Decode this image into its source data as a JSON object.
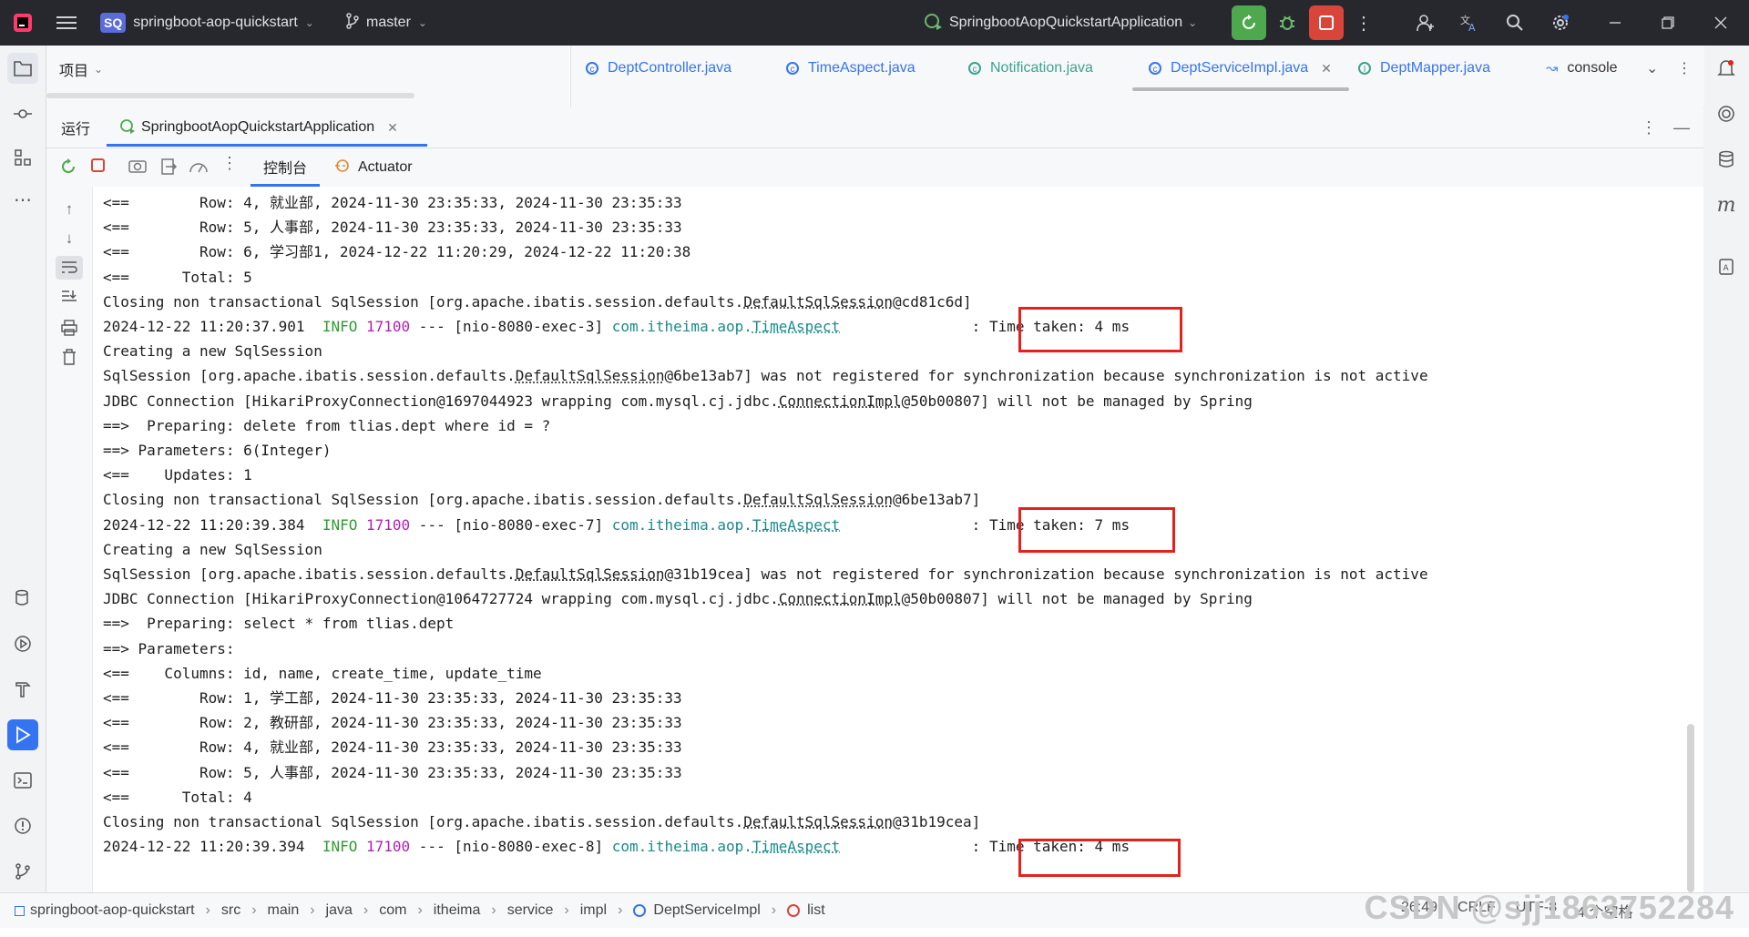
{
  "titlebar": {
    "project_badge": "SQ",
    "project_name": "springboot-aop-quickstart",
    "branch": "master",
    "run_config": "SpringbootAopQuickstartApplication"
  },
  "project_panel": {
    "title": "项目"
  },
  "editor_tabs": [
    {
      "label": "DeptController.java",
      "icon": "class-icon"
    },
    {
      "label": "TimeAspect.java",
      "icon": "class-icon"
    },
    {
      "label": "Notification.java",
      "icon": "class-icon"
    },
    {
      "label": "DeptServiceImpl.java",
      "icon": "class-icon",
      "active": true
    },
    {
      "label": "DeptMapper.java",
      "icon": "interface-icon"
    },
    {
      "label": "console",
      "icon": "console-icon"
    }
  ],
  "run_panel": {
    "title": "运行",
    "config_tab": "SpringbootAopQuickstartApplication",
    "tab_console": "控制台",
    "tab_actuator": "Actuator"
  },
  "console_lines": [
    {
      "parts": [
        {
          "t": "<==        Row: 4, 就业部, 2024-11-30 23:35:33, 2024-11-30 23:35:33"
        }
      ]
    },
    {
      "parts": [
        {
          "t": "<==        Row: 5, 人事部, 2024-11-30 23:35:33, 2024-11-30 23:35:33"
        }
      ]
    },
    {
      "parts": [
        {
          "t": "<==        Row: 6, 学习部1, 2024-12-22 11:20:29, 2024-12-22 11:20:38"
        }
      ]
    },
    {
      "parts": [
        {
          "t": "<==      Total: 5"
        }
      ]
    },
    {
      "parts": [
        {
          "t": "Closing non transactional SqlSession [org.apache.ibatis.session.defaults."
        },
        {
          "t": "DefaultSqlSession",
          "c": "ul"
        },
        {
          "t": "@cd81c6d]"
        }
      ]
    },
    {
      "parts": [
        {
          "t": "2024-12-22 11:20:37.901  "
        },
        {
          "t": "INFO",
          "c": "info"
        },
        {
          "t": " "
        },
        {
          "t": "17100",
          "c": "pid"
        },
        {
          "t": " --- [nio-8080-exec-3] "
        },
        {
          "t": "com.itheima.aop.",
          "c": "cls"
        },
        {
          "t": "TimeAspect",
          "c": "cls ul"
        },
        {
          "t": "               : Time taken: 4 ms"
        }
      ]
    },
    {
      "parts": [
        {
          "t": "Creating a new SqlSession"
        }
      ]
    },
    {
      "parts": [
        {
          "t": "SqlSession [org.apache.ibatis.session.defaults."
        },
        {
          "t": "DefaultSqlSession",
          "c": "ul"
        },
        {
          "t": "@6be13ab7] was not registered for synchronization because synchronization is not active"
        }
      ]
    },
    {
      "parts": [
        {
          "t": "JDBC Connection [HikariProxyConnection@1697044923 wrapping com.mysql.cj.jdbc."
        },
        {
          "t": "ConnectionImpl",
          "c": "ul"
        },
        {
          "t": "@50b00807] will not be managed by Spring"
        }
      ]
    },
    {
      "parts": [
        {
          "t": "==>  Preparing: delete from tlias.dept where id = ?"
        }
      ]
    },
    {
      "parts": [
        {
          "t": "==> Parameters: 6(Integer)"
        }
      ]
    },
    {
      "parts": [
        {
          "t": "<==    Updates: 1"
        }
      ]
    },
    {
      "parts": [
        {
          "t": "Closing non transactional SqlSession [org.apache.ibatis.session.defaults."
        },
        {
          "t": "DefaultSqlSession",
          "c": "ul"
        },
        {
          "t": "@6be13ab7]"
        }
      ]
    },
    {
      "parts": [
        {
          "t": "2024-12-22 11:20:39.384  "
        },
        {
          "t": "INFO",
          "c": "info"
        },
        {
          "t": " "
        },
        {
          "t": "17100",
          "c": "pid"
        },
        {
          "t": " --- [nio-8080-exec-7] "
        },
        {
          "t": "com.itheima.aop.",
          "c": "cls"
        },
        {
          "t": "TimeAspect",
          "c": "cls ul"
        },
        {
          "t": "               : Time taken: 7 ms"
        }
      ]
    },
    {
      "parts": [
        {
          "t": "Creating a new SqlSession"
        }
      ]
    },
    {
      "parts": [
        {
          "t": "SqlSession [org.apache.ibatis.session.defaults."
        },
        {
          "t": "DefaultSqlSession",
          "c": "ul"
        },
        {
          "t": "@31b19cea] was not registered for synchronization because synchronization is not active"
        }
      ]
    },
    {
      "parts": [
        {
          "t": "JDBC Connection [HikariProxyConnection@1064727724 wrapping com.mysql.cj.jdbc."
        },
        {
          "t": "ConnectionImpl",
          "c": "ul"
        },
        {
          "t": "@50b00807] will not be managed by Spring"
        }
      ]
    },
    {
      "parts": [
        {
          "t": "==>  Preparing: select * from tlias.dept"
        }
      ]
    },
    {
      "parts": [
        {
          "t": "==> Parameters: "
        }
      ]
    },
    {
      "parts": [
        {
          "t": "<==    Columns: id, name, create_time, update_time"
        }
      ]
    },
    {
      "parts": [
        {
          "t": "<==        Row: 1, 学工部, 2024-11-30 23:35:33, 2024-11-30 23:35:33"
        }
      ]
    },
    {
      "parts": [
        {
          "t": "<==        Row: 2, 教研部, 2024-11-30 23:35:33, 2024-11-30 23:35:33"
        }
      ]
    },
    {
      "parts": [
        {
          "t": "<==        Row: 4, 就业部, 2024-11-30 23:35:33, 2024-11-30 23:35:33"
        }
      ]
    },
    {
      "parts": [
        {
          "t": "<==        Row: 5, 人事部, 2024-11-30 23:35:33, 2024-11-30 23:35:33"
        }
      ]
    },
    {
      "parts": [
        {
          "t": "<==      Total: 4"
        }
      ]
    },
    {
      "parts": [
        {
          "t": "Closing non transactional SqlSession [org.apache.ibatis.session.defaults."
        },
        {
          "t": "DefaultSqlSession",
          "c": "ul"
        },
        {
          "t": "@31b19cea]"
        }
      ]
    },
    {
      "parts": [
        {
          "t": "2024-12-22 11:20:39.394  "
        },
        {
          "t": "INFO",
          "c": "info"
        },
        {
          "t": " "
        },
        {
          "t": "17100",
          "c": "pid"
        },
        {
          "t": " --- [nio-8080-exec-8] "
        },
        {
          "t": "com.itheima.aop.",
          "c": "cls"
        },
        {
          "t": "TimeAspect",
          "c": "cls ul"
        },
        {
          "t": "               : Time taken: 4 ms"
        }
      ]
    }
  ],
  "breadcrumb": [
    "springboot-aop-quickstart",
    "src",
    "main",
    "java",
    "com",
    "itheima",
    "service",
    "impl",
    "DeptServiceImpl",
    "list"
  ],
  "status": {
    "position": "26:49",
    "line_ending": "CRLF",
    "encoding": "UTF-8",
    "indent": "4 个空格"
  },
  "watermark": "CSDN @sjj1863752284",
  "colors": {
    "accent": "#3574f0",
    "highlight_box": "#e3231b",
    "run_green": "#4ea84e",
    "stop_red": "#d9453a"
  }
}
